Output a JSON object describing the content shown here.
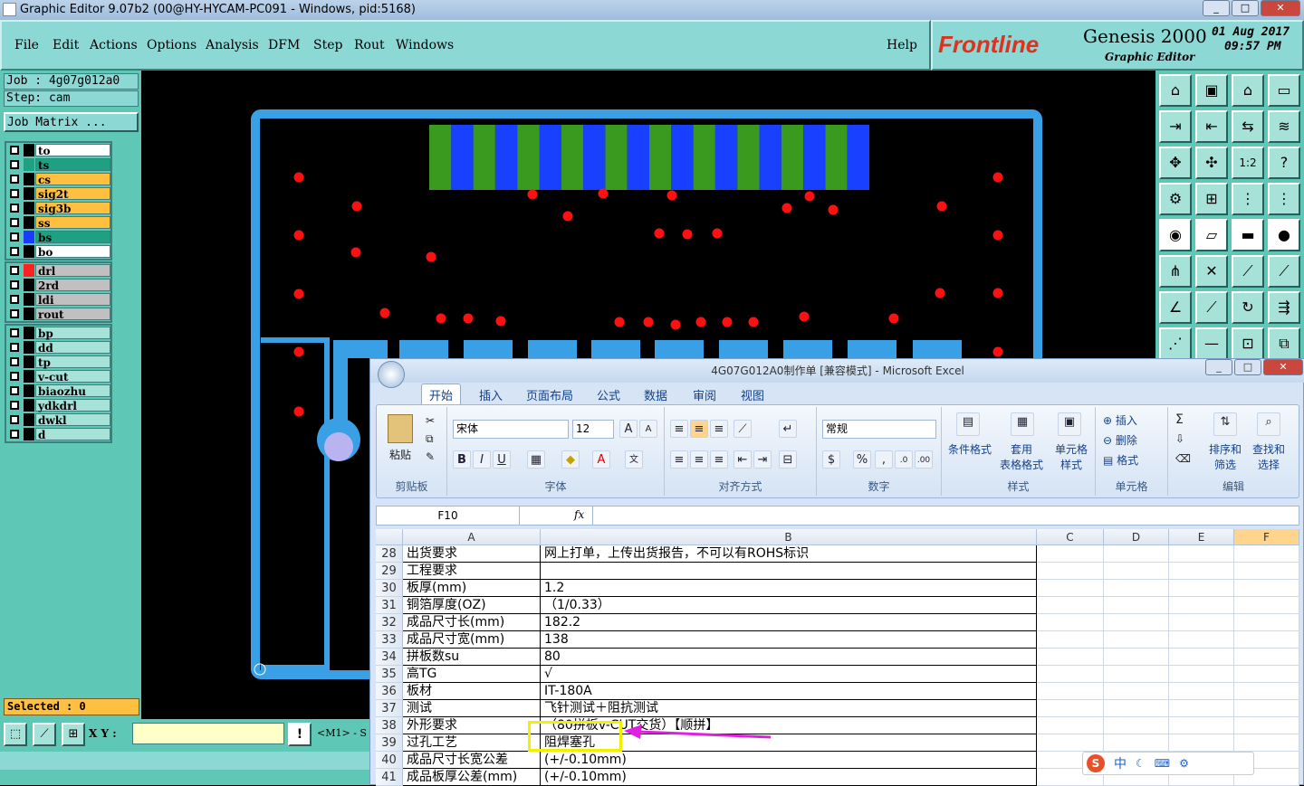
{
  "window": {
    "title": "Graphic Editor 9.07b2 (00@HY-HYCAM-PC091 - Windows, pid:5168)"
  },
  "menu": {
    "items": [
      "File",
      "Edit",
      "Actions",
      "Options",
      "Analysis",
      "DFM",
      "Step",
      "Rout",
      "Windows"
    ],
    "help": "Help"
  },
  "brand": {
    "logo": "Frontline",
    "product": "Genesis 2000",
    "subtitle": "Graphic Editor",
    "date": "01 Aug 2017",
    "time": "09:57 PM"
  },
  "job": {
    "job_label": "Job : 4g07g012a0",
    "step_label": "Step: cam",
    "matrix_button": "Job Matrix ..."
  },
  "layers_group1": [
    {
      "name": "to",
      "color": "white",
      "swatch": "#000000"
    },
    {
      "name": "ts",
      "color": "green",
      "swatch": "#1fa083"
    },
    {
      "name": "cs",
      "color": "orange",
      "swatch": "#000000"
    },
    {
      "name": "sig2t",
      "color": "orange",
      "swatch": "#000000"
    },
    {
      "name": "sig3b",
      "color": "orange",
      "swatch": "#000000"
    },
    {
      "name": "ss",
      "color": "orange",
      "swatch": "#000000"
    },
    {
      "name": "bs",
      "color": "green",
      "swatch": "#1a3cff"
    },
    {
      "name": "bo",
      "color": "white",
      "swatch": "#000000"
    }
  ],
  "layers_group2": [
    {
      "name": "drl",
      "color": "grey",
      "swatch": "#ff2020"
    },
    {
      "name": "2rd",
      "color": "grey",
      "swatch": "#000000"
    },
    {
      "name": "ldi",
      "color": "grey",
      "swatch": "#000000"
    },
    {
      "name": "rout",
      "color": "grey",
      "swatch": "#000000"
    }
  ],
  "layers_group3": [
    {
      "name": "bp",
      "color": "teal",
      "swatch": "#000000"
    },
    {
      "name": "dd",
      "color": "teal",
      "swatch": "#000000"
    },
    {
      "name": "tp",
      "color": "teal",
      "swatch": "#000000"
    },
    {
      "name": "v-cut",
      "color": "teal",
      "swatch": "#000000"
    },
    {
      "name": "biaozhu",
      "color": "teal",
      "swatch": "#000000"
    },
    {
      "name": "ydkdrl",
      "color": "teal",
      "swatch": "#000000"
    },
    {
      "name": "dwkl",
      "color": "teal",
      "swatch": "#000000"
    },
    {
      "name": "d",
      "color": "teal",
      "swatch": "#000000"
    }
  ],
  "status": {
    "selected": "Selected : 0",
    "xy_label": "X Y :",
    "xy_value": "",
    "m1": "<M1> - S"
  },
  "excel": {
    "title": "4G07G012A0制作单  [兼容模式] - Microsoft Excel",
    "tabs": [
      "开始",
      "插入",
      "页面布局",
      "公式",
      "数据",
      "审阅",
      "视图"
    ],
    "groups": [
      "剪贴板",
      "字体",
      "对齐方式",
      "数字",
      "样式",
      "单元格",
      "编辑"
    ],
    "paste": "粘贴",
    "font_name": "宋体",
    "font_size": "12",
    "number_format": "常规",
    "style_buttons": [
      "条件格式",
      "套用\n表格格式",
      "单元格\n样式"
    ],
    "cell_buttons": [
      "插入",
      "删除",
      "格式"
    ],
    "edit_buttons": [
      "排序和\n筛选",
      "查找和\n选择"
    ],
    "name_box": "F10",
    "fx": "fx",
    "columns": [
      "A",
      "B",
      "C",
      "D",
      "E",
      "F"
    ],
    "rows": [
      {
        "n": "28",
        "a": "出货要求",
        "b": "网上打单，上传出货报告，不可以有ROHS标识"
      },
      {
        "n": "29",
        "a": "工程要求",
        "b": ""
      },
      {
        "n": "30",
        "a": "板厚(mm)",
        "b": "1.2"
      },
      {
        "n": "31",
        "a": "铜箔厚度(OZ)",
        "b": "（1/0.33）"
      },
      {
        "n": "32",
        "a": "成品尺寸长(mm)",
        "b": "182.2"
      },
      {
        "n": "33",
        "a": "成品尺寸宽(mm)",
        "b": "138"
      },
      {
        "n": "34",
        "a": "拼板数su",
        "b": "80"
      },
      {
        "n": "35",
        "a": "高TG",
        "b": "√"
      },
      {
        "n": "36",
        "a": "板材",
        "b": "IT-180A"
      },
      {
        "n": "37",
        "a": "测试",
        "b": "飞针测试＋阻抗测试"
      },
      {
        "n": "38",
        "a": "外形要求",
        "b": "（80拼板v-CUT交货）【顺拼】"
      },
      {
        "n": "39",
        "a": "过孔工艺",
        "b": "阻焊塞孔"
      },
      {
        "n": "40",
        "a": "成品尺寸长宽公差",
        "b": "(+/-0.10mm)"
      },
      {
        "n": "41",
        "a": "成品板厚公差(mm)",
        "b": "(+/-0.10mm)"
      }
    ]
  },
  "ime": {
    "label": "中"
  }
}
